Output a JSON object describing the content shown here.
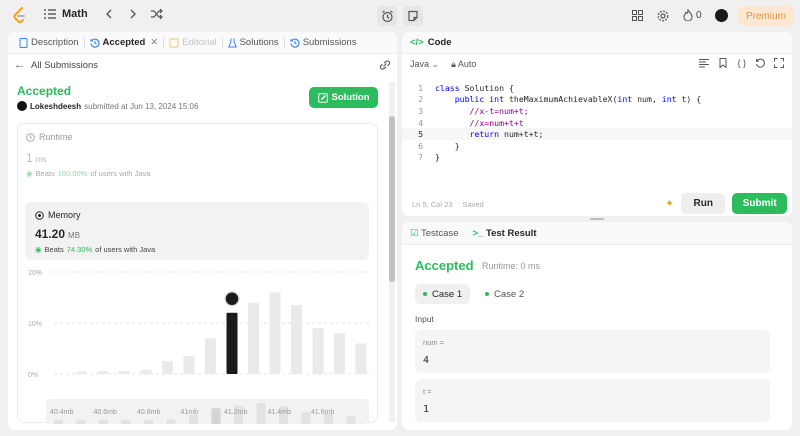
{
  "topbar": {
    "problem_list": "Math",
    "streak_count": "0",
    "premium": "Premium"
  },
  "left": {
    "tabs": [
      {
        "label": "Description"
      },
      {
        "label": "Accepted"
      },
      {
        "label": "Editorial"
      },
      {
        "label": "Solutions"
      },
      {
        "label": "Submissions"
      }
    ],
    "back_label": "All Submissions",
    "status": "Accepted",
    "submitter": "Lokeshdeesh",
    "submitted_text": "submitted at Jun 13, 2024 15:06",
    "solution_button": "Solution",
    "runtime": {
      "label": "Runtime",
      "value": "1",
      "unit": "ms",
      "beats_prefix": "Beats",
      "beats_pct": "100.00%",
      "beats_suffix": "of users with Java"
    },
    "memory": {
      "label": "Memory",
      "value": "41.20",
      "unit": "MB",
      "beats_prefix": "Beats",
      "beats_pct": "74.30%",
      "beats_suffix": "of users with Java"
    }
  },
  "chart_data": {
    "type": "bar",
    "y_ticks": [
      "20%",
      "10%",
      "0%"
    ],
    "ylim": [
      0,
      20
    ],
    "x_ticks": [
      "40.4mb",
      "40.6mb",
      "40.8mb",
      "41mb",
      "41.2mb",
      "41.4mb",
      "41.6mb"
    ],
    "values": [
      0.5,
      0.6,
      0.6,
      0.8,
      2.5,
      3.5,
      7,
      12,
      14,
      16,
      13.5,
      9,
      8,
      6
    ],
    "highlight_index": 7,
    "brush_x_ticks": [
      "40.4mb",
      "40.6mb",
      "40.8mb",
      "41mb",
      "41.2mb",
      "41.4mb",
      "41.6mb"
    ]
  },
  "code": {
    "title": "Code",
    "language": "Java",
    "mode": "Auto",
    "lines": [
      {
        "n": "1",
        "text": "class Solution {"
      },
      {
        "n": "2",
        "text": "    public int theMaximumAchievableX(int num, int t) {"
      },
      {
        "n": "3",
        "text": "       //x-t=num+t;"
      },
      {
        "n": "4",
        "text": "       //x=num+t+t"
      },
      {
        "n": "5",
        "text": "       return num+t+t;"
      },
      {
        "n": "6",
        "text": "    }"
      },
      {
        "n": "7",
        "text": "}"
      }
    ],
    "cursor": "Ln 5, Col 23",
    "saved": "Saved",
    "run": "Run",
    "submit": "Submit"
  },
  "result": {
    "tab_testcase": "Testcase",
    "tab_result": "Test Result",
    "status": "Accepted",
    "runtime": "Runtime: 0 ms",
    "cases": [
      "Case 1",
      "Case 2"
    ],
    "input_label": "Input",
    "vars": [
      {
        "name": "num =",
        "value": "4"
      },
      {
        "name": "t =",
        "value": "1"
      }
    ]
  },
  "colors": {
    "accent_green": "#2cbb5d",
    "premium": "#e3963a",
    "keyword": "#0000ff",
    "comment": "#8b008b"
  }
}
